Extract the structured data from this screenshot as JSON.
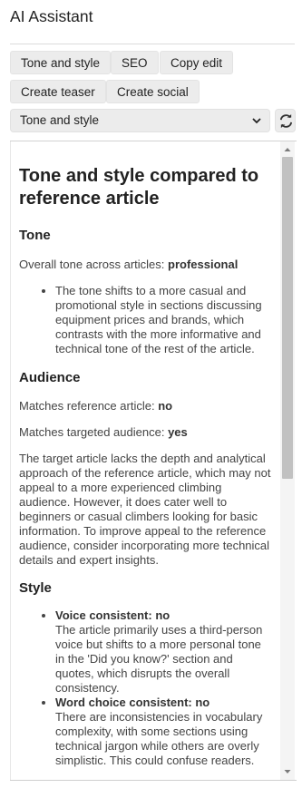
{
  "app": {
    "title": "AI Assistant"
  },
  "actions": [
    {
      "label": "Tone and style"
    },
    {
      "label": "SEO"
    },
    {
      "label": "Copy edit"
    },
    {
      "label": "Create teaser"
    },
    {
      "label": "Create social"
    }
  ],
  "mode_select": {
    "value": "Tone and style",
    "icon": "chevron-down-icon"
  },
  "refresh": {
    "icon": "refresh-icon"
  },
  "report": {
    "title": "Tone and style compared to reference article",
    "tone": {
      "heading": "Tone",
      "overall_label": "Overall tone across articles:",
      "overall_value": "professional",
      "notes": [
        "The tone shifts to a more casual and promotional style in sections discussing equipment prices and brands, which contrasts with the more informative and technical tone of the rest of the article."
      ]
    },
    "audience": {
      "heading": "Audience",
      "reference_label": "Matches reference article:",
      "reference_value": "no",
      "targeted_label": "Matches targeted audience:",
      "targeted_value": "yes",
      "body": "The target article lacks the depth and analytical approach of the reference article, which may not appeal to a more experienced climbing audience. However, it does cater well to beginners or casual climbers looking for basic information. To improve appeal to the reference audience, consider incorporating more technical details and expert insights."
    },
    "style": {
      "heading": "Style",
      "items": [
        {
          "label": "Voice consistent:",
          "value": "no",
          "text": "The article primarily uses a third-person voice but shifts to a more personal tone in the 'Did you know?' section and quotes, which disrupts the overall consistency."
        },
        {
          "label": "Word choice consistent:",
          "value": "no",
          "text": "There are inconsistencies in vocabulary complexity, with some sections using technical jargon while others are overly simplistic. This could confuse readers."
        }
      ]
    }
  },
  "colors": {
    "chip_bg": "#ececec",
    "text": "#444444",
    "heading": "#222222",
    "scroll_thumb": "#c1c1c1"
  }
}
